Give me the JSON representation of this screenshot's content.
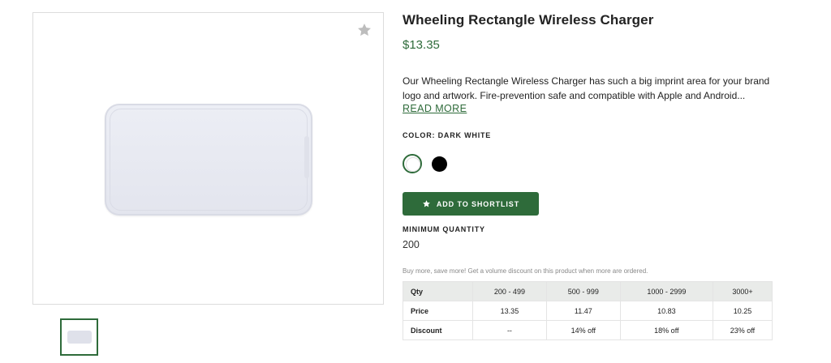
{
  "product": {
    "title": "Wheeling Rectangle Wireless Charger",
    "price": "$13.35",
    "description": "Our Wheeling Rectangle Wireless Charger has such a big imprint area for your brand logo and artwork. Fire-prevention safe and compatible with Apple and Android...",
    "read_more_label": "READ MORE"
  },
  "color": {
    "label": "COLOR: DARK WHITE",
    "swatches": [
      {
        "name": "Dark White",
        "hex": "#ffffff",
        "selected": true
      },
      {
        "name": "Black",
        "hex": "#000000",
        "selected": false
      }
    ]
  },
  "actions": {
    "shortlist_label": "ADD TO SHORTLIST",
    "favorite_icon": "star-icon"
  },
  "minimum_quantity": {
    "label": "MINIMUM QUANTITY",
    "value": "200"
  },
  "volume": {
    "note": "Buy more, save more! Get a volume discount on this product when more are ordered.",
    "headers": [
      "Qty",
      "200 - 499",
      "500 - 999",
      "1000 - 2999",
      "3000+"
    ],
    "rows": [
      [
        "Price",
        "13.35",
        "11.47",
        "10.83",
        "10.25"
      ],
      [
        "Discount",
        "--",
        "14% off",
        "18% off",
        "23% off"
      ]
    ]
  },
  "colors": {
    "accent": "#2e6b3a"
  }
}
